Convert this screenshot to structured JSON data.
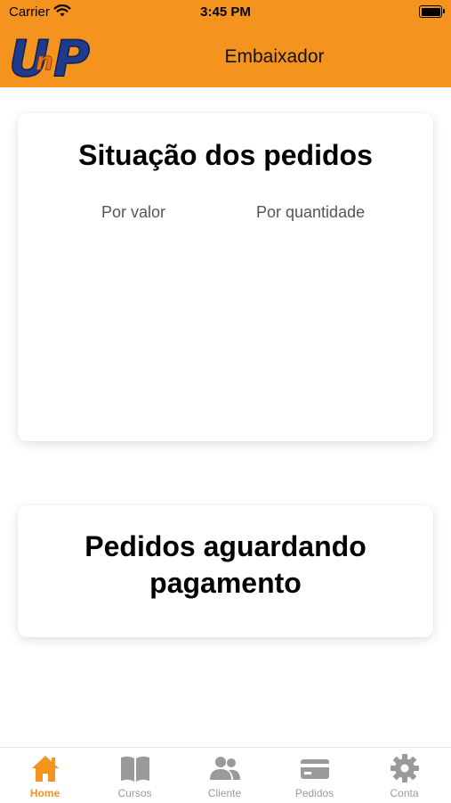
{
  "status_bar": {
    "carrier": "Carrier",
    "time": "3:45 PM"
  },
  "header": {
    "title": "Embaixador",
    "logo_text": "UnP",
    "color": "#f5931f"
  },
  "situacao_card": {
    "title": "Situação dos pedidos",
    "tabs": [
      "Por valor",
      "Por quantidade"
    ]
  },
  "pagamento_card": {
    "title": "Pedidos aguardando pagamento"
  },
  "tab_bar": {
    "items": [
      {
        "label": "Home",
        "icon": "home-icon",
        "active": true
      },
      {
        "label": "Cursos",
        "icon": "book-icon",
        "active": false
      },
      {
        "label": "Cliente",
        "icon": "users-icon",
        "active": false
      },
      {
        "label": "Pedidos",
        "icon": "credit-card-icon",
        "active": false
      },
      {
        "label": "Conta",
        "icon": "gear-icon",
        "active": false
      }
    ],
    "active_color": "#f5931f",
    "inactive_color": "#9a9a9a"
  }
}
